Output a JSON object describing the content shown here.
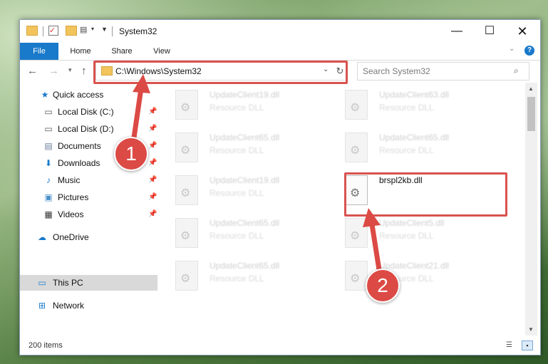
{
  "window": {
    "title": "System32",
    "controls": {
      "minimize": "—",
      "maximize": "☐",
      "close": "✕"
    }
  },
  "ribbon": {
    "tabs": [
      "File",
      "Home",
      "Share",
      "View"
    ],
    "collapse": "⌄",
    "help": "?"
  },
  "nav": {
    "address": "C:\\Windows\\System32",
    "search_placeholder": "Search System32"
  },
  "sidebar": {
    "items": [
      {
        "label": "Quick access",
        "icon": "star-icon",
        "glyph": "★",
        "color": "#1979ca"
      },
      {
        "label": "Local Disk (C:)",
        "icon": "drive-c-icon",
        "glyph": "▭",
        "color": "#555"
      },
      {
        "label": "Local Disk (D:)",
        "icon": "drive-d-icon",
        "glyph": "▭",
        "color": "#555"
      },
      {
        "label": "Documents",
        "icon": "documents-icon",
        "glyph": "▤",
        "color": "#6a7f9a"
      },
      {
        "label": "Downloads",
        "icon": "downloads-icon",
        "glyph": "⬇",
        "color": "#1979ca"
      },
      {
        "label": "Music",
        "icon": "music-icon",
        "glyph": "♪",
        "color": "#1979ca"
      },
      {
        "label": "Pictures",
        "icon": "pictures-icon",
        "glyph": "▣",
        "color": "#4a90c8"
      },
      {
        "label": "Videos",
        "icon": "videos-icon",
        "glyph": "▦",
        "color": "#333"
      },
      {
        "label": "OneDrive",
        "icon": "onedrive-icon",
        "glyph": "☁",
        "color": "#1979ca"
      },
      {
        "label": "This PC",
        "icon": "this-pc-icon",
        "glyph": "▭",
        "color": "#1979ca"
      },
      {
        "label": "Network",
        "icon": "network-icon",
        "glyph": "⊞",
        "color": "#1979ca"
      }
    ],
    "pin_glyph": "📌"
  },
  "files": {
    "left": [
      {
        "name": "UpdateClient19.dll",
        "desc": "Resource DLL"
      },
      {
        "name": "UpdateClient65.dll",
        "desc": "Resource DLL"
      },
      {
        "name": "UpdateClient19.dll",
        "desc": "Resource DLL"
      },
      {
        "name": "UpdateClient65.dll",
        "desc": "Resource DLL"
      },
      {
        "name": "UpdateClient65.dll",
        "desc": "Resource DLL"
      }
    ],
    "right": [
      {
        "name": "UpdateClient63.dll",
        "desc": "Resource DLL"
      },
      {
        "name": "UpdateClient65.dll",
        "desc": "Resource DLL"
      },
      {
        "name": "brspl2kb.dll",
        "desc": ""
      },
      {
        "name": "UpdateClient5.dll",
        "desc": "Resource DLL"
      },
      {
        "name": "UpdateClient21.dll",
        "desc": "Resource DLL"
      }
    ]
  },
  "status": {
    "count": "200 items"
  },
  "annotations": {
    "step1": "1",
    "step2": "2",
    "color": "#dc4a45"
  }
}
